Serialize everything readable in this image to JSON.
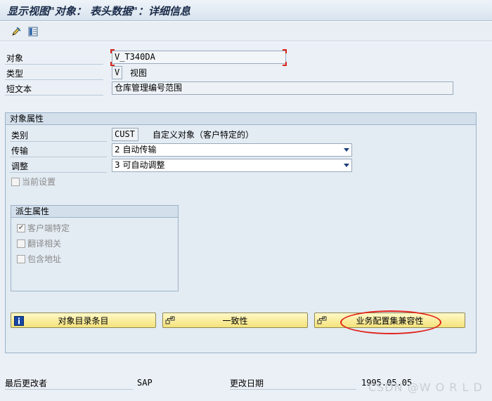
{
  "window": {
    "title": "显示视图\"对象： 表头数据\"：详细信息"
  },
  "toolbar": {
    "icons": [
      "pencil-icon",
      "details-icon"
    ]
  },
  "header_fields": {
    "object_label": "对象",
    "object_value": "V_T340DA",
    "type_label": "类型",
    "type_value": "V",
    "type_desc": "视图",
    "short_text_label": "短文本",
    "short_text_value": "仓库管理编号范围"
  },
  "object_attributes": {
    "title": "对象属性",
    "category_label": "类别",
    "category_value": "CUST",
    "category_desc": "自定义对象（客户特定的）",
    "transport_label": "传输",
    "transport_value": "2 自动传输",
    "adjust_label": "调整",
    "adjust_value": "3 可自动调整",
    "current_settings_label": "当前设置",
    "current_settings_checked": false
  },
  "derived_attributes": {
    "title": "派生属性",
    "items": [
      {
        "label": "客户端特定",
        "checked": true
      },
      {
        "label": "翻译相关",
        "checked": false
      },
      {
        "label": "包含地址",
        "checked": false
      }
    ]
  },
  "buttons": {
    "catalog_entry": "对象目录条目",
    "consistency": "一致性",
    "bc_set_compat": "业务配置集兼容性"
  },
  "footer": {
    "last_changed_by_label": "最后更改者",
    "last_changed_by_value": "SAP",
    "change_date_label": "更改日期",
    "change_date_value": "1995.05.05"
  },
  "watermark": "CSDN @W O R L D",
  "colors": {
    "button_yellow": "#f5e27a",
    "highlight_red": "#e2231a",
    "panel_blue": "#eaf0f6"
  }
}
